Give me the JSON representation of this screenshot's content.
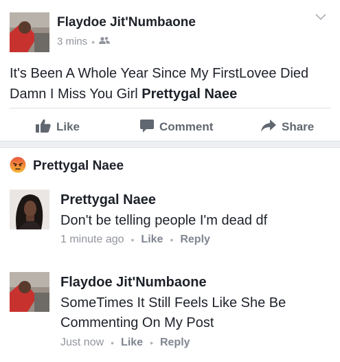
{
  "post": {
    "author": "Flaydoe Jit'Numbaone",
    "time": "3 mins",
    "text_main": "It's Been A Whole Year Since My FirstLovee Died Damn I Miss You Girl ",
    "text_tag": "Prettygal Naee",
    "privacy_icon": "friends-icon"
  },
  "actions": {
    "like": "Like",
    "comment": "Comment",
    "share": "Share"
  },
  "reaction": {
    "icon": "angry-reaction-icon",
    "name": "Prettygal Naee"
  },
  "comments": [
    {
      "author": "Prettygal Naee",
      "text": "Don't be telling people I'm dead df",
      "time": "1 minute ago",
      "like": "Like",
      "reply": "Reply"
    },
    {
      "author": "Flaydoe Jit'Numbaone",
      "text": "SomeTimes It Still Feels Like She Be Commenting On My Post",
      "time": "Just now",
      "like": "Like",
      "reply": "Reply"
    }
  ],
  "colors": {
    "text": "#1d2129",
    "secondary": "#90949c",
    "action": "#616770",
    "angry": "#f0781a"
  }
}
